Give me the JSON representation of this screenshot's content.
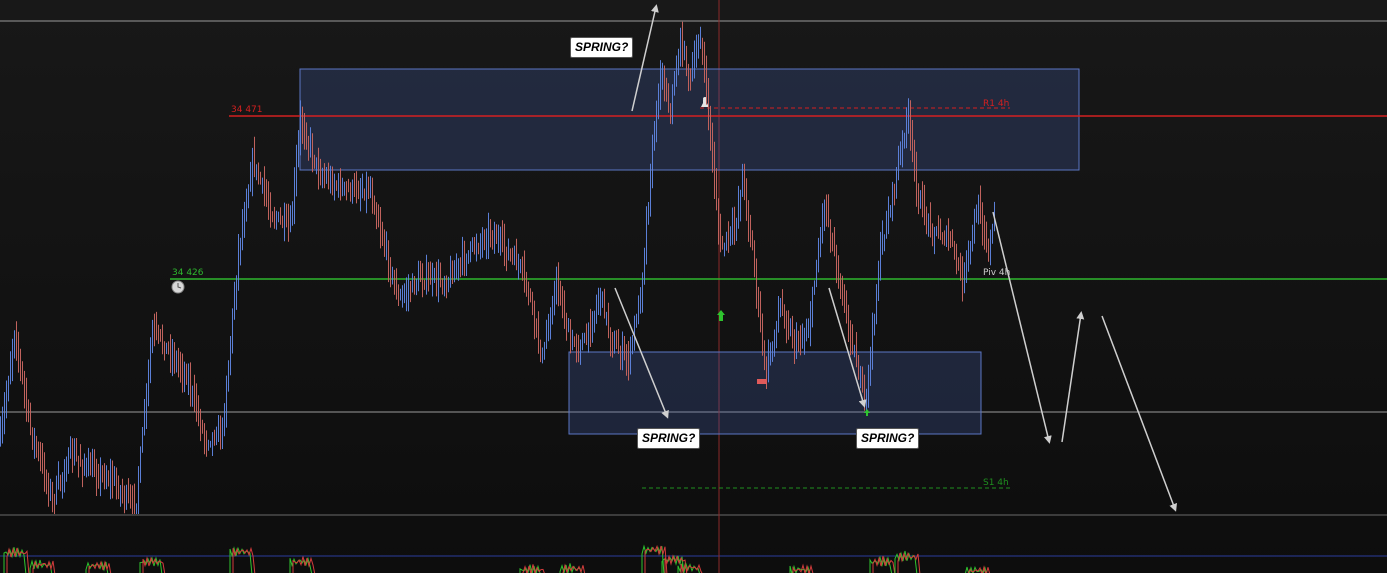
{
  "chart_data": {
    "type": "candlestick",
    "levels": [
      {
        "name": "R1 4h",
        "value": 34471,
        "color": "#d42020",
        "price_label": "34 471"
      },
      {
        "name": "Piv 4h",
        "value": 34426,
        "color": "#2eb82e",
        "price_label": "34 426"
      },
      {
        "name": "S1 4h",
        "value": 34325,
        "color": "#1f8f1f"
      }
    ],
    "annotations": [
      "SPRING?",
      "SPRING?",
      "SPRING?"
    ],
    "colors": {
      "background": "#111111",
      "up": "#5b7fd6",
      "down": "#c0625d",
      "zone_fill": "rgba(70,95,170,0.28)",
      "zone_stroke": "#5b76c4",
      "arrow": "#cfcfcf"
    }
  }
}
